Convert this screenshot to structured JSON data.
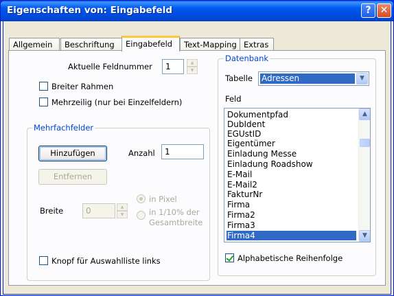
{
  "window": {
    "title": "Eigenschaften von: Eingabefeld",
    "help_glyph": "?",
    "close_glyph": "✕"
  },
  "tabs": [
    {
      "label": "Allgemein",
      "active": false
    },
    {
      "label": "Beschriftung",
      "active": false
    },
    {
      "label": "Eingabefeld",
      "active": true
    },
    {
      "label": "Text-Mapping",
      "active": false
    },
    {
      "label": "Extras",
      "active": false
    }
  ],
  "eingabefeld": {
    "feldnummer_label": "Aktuelle Feldnummer",
    "feldnummer_value": "1",
    "breiter_rahmen": {
      "label": "Breiter Rahmen",
      "checked": false
    },
    "mehrzeilig": {
      "label": "Mehrzeilig (nur bei Einzelfeldern)",
      "checked": false
    }
  },
  "mehrfachfelder": {
    "title": "Mehrfachfelder",
    "add_button": "Hinzufügen",
    "remove_button": "Entfernen",
    "anzahl_label": "Anzahl",
    "anzahl_value": "1",
    "breite_label": "Breite",
    "breite_value": "0",
    "radio_pixel": "in Pixel",
    "radio_percent_line1": "in 1/10% der",
    "radio_percent_line2": "Gesamtbreite",
    "knopf_checkbox": {
      "label": "Knopf für Auswahlliste links",
      "checked": false
    }
  },
  "datenbank": {
    "title": "Datenbank",
    "tabelle_label": "Tabelle",
    "tabelle_value": "Adressen",
    "feld_label": "Feld",
    "fields": [
      "Dokumentpfad",
      "DubIdent",
      "EGUstID",
      "Eigentümer",
      "Einladung Messe",
      "Einladung Roadshow",
      "E-Mail",
      "E-Mail2",
      "FakturNr",
      "Firma",
      "Firma2",
      "Firma3",
      "Firma4"
    ],
    "selected_field": "Firma4",
    "alphabetical": {
      "label": "Alphabetische Reihenfolge",
      "checked": true
    }
  },
  "colors": {
    "titlebar": "#0054e3",
    "selection": "#316ac5",
    "group_title": "#0046d5",
    "active_tab_highlight": "#ffc83c"
  }
}
